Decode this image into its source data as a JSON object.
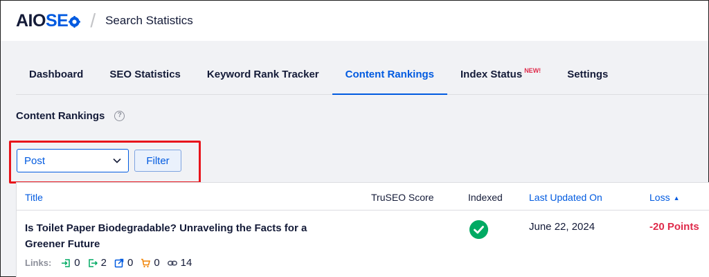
{
  "header": {
    "logo_aio": "AIO",
    "logo_seo": "SE",
    "separator": "/",
    "title": "Search Statistics"
  },
  "tabs": [
    {
      "label": "Dashboard",
      "active": false
    },
    {
      "label": "SEO Statistics",
      "active": false
    },
    {
      "label": "Keyword Rank Tracker",
      "active": false
    },
    {
      "label": "Content Rankings",
      "active": true
    },
    {
      "label": "Index Status",
      "badge": "NEW!",
      "active": false
    },
    {
      "label": "Settings",
      "active": false
    }
  ],
  "section": {
    "title": "Content Rankings",
    "help_icon": "question-circle-icon"
  },
  "filter": {
    "select_value": "Post",
    "button_label": "Filter"
  },
  "table": {
    "columns": {
      "title": "Title",
      "truseo": "TruSEO Score",
      "indexed": "Indexed",
      "last_updated": "Last Updated On",
      "loss": "Loss",
      "loss_sort_icon": "▲"
    },
    "rows": [
      {
        "title": "Is Toilet Paper Biodegradable? Unraveling the Facts for a Greener Future",
        "indexed": true,
        "last_updated": "June 22, 2024",
        "loss": "-20 Points",
        "links_label": "Links:",
        "links": {
          "internal_inbound": "0",
          "internal_outbound": "2",
          "external": "0",
          "affiliate": "0",
          "suggestions": "14"
        }
      }
    ]
  },
  "colors": {
    "accent": "#005ae0",
    "danger": "#df2a4a",
    "success": "#00aa63",
    "highlight": "#e8141b"
  }
}
